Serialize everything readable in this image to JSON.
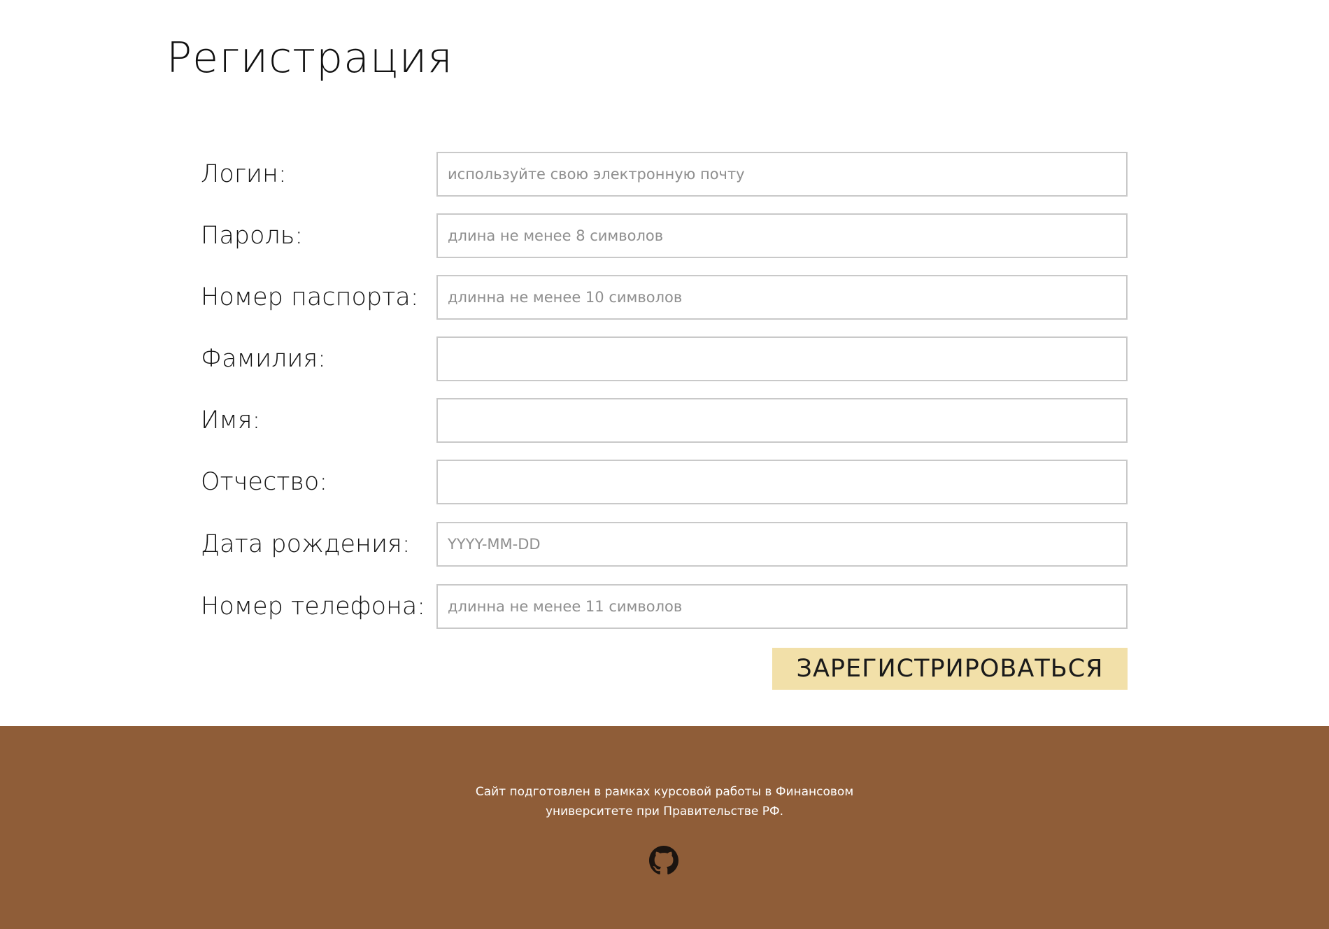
{
  "page": {
    "title": "Регистрация"
  },
  "form": {
    "fields": [
      {
        "label": "Логин:",
        "placeholder": "используйте свою электронную почту",
        "value": ""
      },
      {
        "label": "Пароль:",
        "placeholder": "длина не менее 8 символов",
        "value": ""
      },
      {
        "label": "Номер паспорта:",
        "placeholder": "длинна не менее 10 символов",
        "value": ""
      },
      {
        "label": "Фамилия:",
        "placeholder": "",
        "value": ""
      },
      {
        "label": "Имя:",
        "placeholder": "",
        "value": ""
      },
      {
        "label": "Отчество:",
        "placeholder": "",
        "value": ""
      },
      {
        "label": "Дата рождения:",
        "placeholder": "YYYY-MM-DD",
        "value": ""
      },
      {
        "label": "Номер телефона:",
        "placeholder": "длинна не менее 11 символов",
        "value": ""
      }
    ],
    "submit_label": "ЗАРЕГИСТРИРОВАТЬСЯ"
  },
  "footer": {
    "text_line1": "Сайт подготовлен в рамках курсовой работы в Финансовом",
    "text_line2": "университете при Правительстве РФ.",
    "icon": "github-icon"
  },
  "colors": {
    "button_bg": "#f2e0a9",
    "footer_bg": "#8f5d38",
    "input_border": "#c9c9c9"
  }
}
